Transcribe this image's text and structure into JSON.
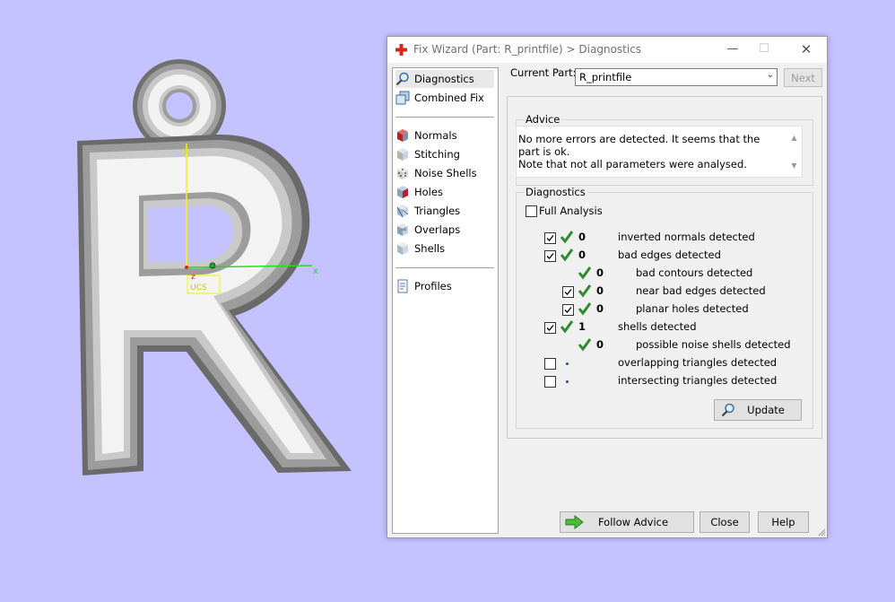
{
  "viewport": {
    "axes": {
      "x": "x",
      "y": "y",
      "z": "z"
    },
    "ucs_label": "UCS"
  },
  "dialog": {
    "title": "Fix Wizard (Part: R_printfile) > Diagnostics",
    "window_buttons": {
      "minimize": "—",
      "maximize": "☐",
      "close": "✕"
    },
    "nav": {
      "top": [
        {
          "label": "Diagnostics",
          "icon": "magnifier-icon"
        },
        {
          "label": "Combined Fix",
          "icon": "combined-fix-icon"
        }
      ],
      "fixes": [
        {
          "label": "Normals",
          "icon": "normals-cube-icon"
        },
        {
          "label": "Stitching",
          "icon": "stitching-cube-icon"
        },
        {
          "label": "Noise Shells",
          "icon": "dice-icon"
        },
        {
          "label": "Holes",
          "icon": "holes-cube-icon"
        },
        {
          "label": "Triangles",
          "icon": "triangles-cube-icon"
        },
        {
          "label": "Overlaps",
          "icon": "overlaps-cube-icon"
        },
        {
          "label": "Shells",
          "icon": "shells-cube-icon"
        }
      ],
      "bottom": [
        {
          "label": "Profiles",
          "icon": "profiles-document-icon"
        }
      ]
    },
    "current_part_label": "Current Part:",
    "current_part_value": "R_printfile",
    "next_label": "Next",
    "advice": {
      "legend": "Advice",
      "line1": "No more errors are detected. It seems that the part is ok.",
      "line2": "Note that not all parameters were analysed."
    },
    "diagnostics": {
      "legend": "Diagnostics",
      "full_analysis_label": "Full Analysis",
      "full_analysis_checked": false,
      "rows": [
        {
          "checked": true,
          "status": "ok",
          "count": "0",
          "label": "inverted normals detected"
        },
        {
          "checked": true,
          "status": "ok",
          "count": "0",
          "label": "bad edges detected"
        },
        {
          "checked": null,
          "status": "ok",
          "count": "0",
          "label": "bad contours detected"
        },
        {
          "checked": true,
          "status": "ok",
          "count": "0",
          "label": "near bad edges detected"
        },
        {
          "checked": true,
          "status": "ok",
          "count": "0",
          "label": "planar holes detected"
        },
        {
          "checked": true,
          "status": "ok",
          "count": "1",
          "label": "shells detected"
        },
        {
          "checked": null,
          "status": "ok",
          "count": "0",
          "label": "possible noise shells detected"
        },
        {
          "checked": false,
          "status": "pending",
          "count": "",
          "label": "overlapping triangles detected"
        },
        {
          "checked": false,
          "status": "pending",
          "count": "",
          "label": "intersecting triangles detected"
        }
      ],
      "update_label": "Update"
    },
    "footer": {
      "follow_advice_label": "Follow Advice",
      "close_label": "Close",
      "help_label": "Help"
    }
  },
  "colors": {
    "desktop_bg": "#c4c2ff",
    "check_green": "#2f8a2f",
    "axis_yellow": "#f5f500",
    "axis_green": "#22dd22"
  }
}
